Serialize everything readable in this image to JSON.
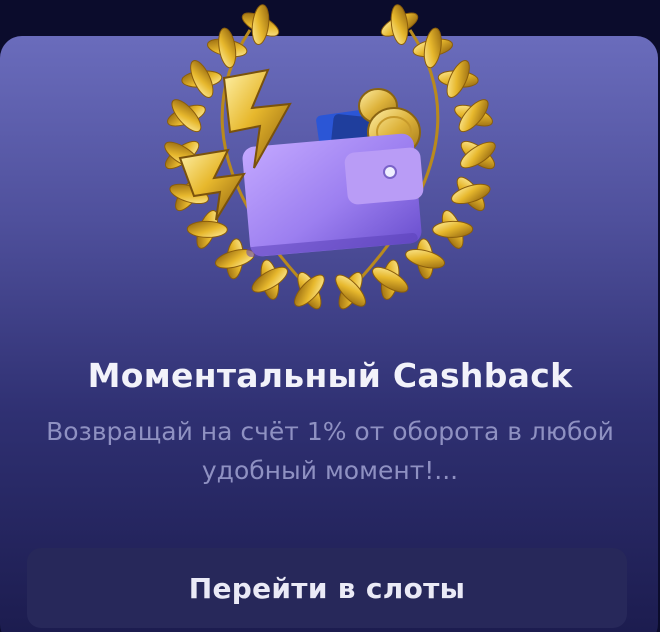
{
  "promo": {
    "title": "Моментальный Cashback",
    "description": "Возвращай на счёт 1% от оборота в любой удобный момент!...",
    "button_label": "Перейти в слоты"
  },
  "colors": {
    "background": "#0b0c2c",
    "card_top": "#6a6cbc",
    "card_bottom": "#1b1b4d",
    "button_bg": "#27285a",
    "title_text": "#f2f2fa",
    "description_text": "#8f91c2",
    "laurel_gold": "#e2b52c",
    "wallet_purple": "#a88af0"
  },
  "icons": {
    "hero": "laurel-wreath-wallet-cashback-illustration"
  }
}
